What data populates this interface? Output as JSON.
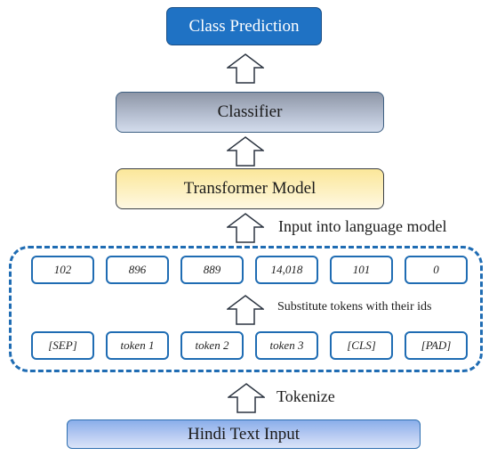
{
  "diagram": {
    "nodes": {
      "class_prediction": "Class Prediction",
      "classifier": "Classifier",
      "transformer_model": "Transformer Model",
      "hindi_text_input": "Hindi Text Input"
    },
    "edge_labels": {
      "input_into_lm": "Input into language model",
      "substitute": "Substitute tokens with their ids",
      "tokenize": "Tokenize"
    },
    "token_ids": [
      "102",
      "896",
      "889",
      "14,018",
      "101",
      "0"
    ],
    "tokens": [
      "[SEP]",
      "token 1",
      "token 2",
      "token 3",
      "[CLS]",
      "[PAD]"
    ],
    "colors": {
      "class_prediction_fill": "#1f72c4",
      "dashed_border": "#1f6cb3",
      "classifier_fill": "#b4bdcf",
      "transformer_fill": "#fdf1c4",
      "hindi_fill": "#b8cbf2"
    }
  }
}
